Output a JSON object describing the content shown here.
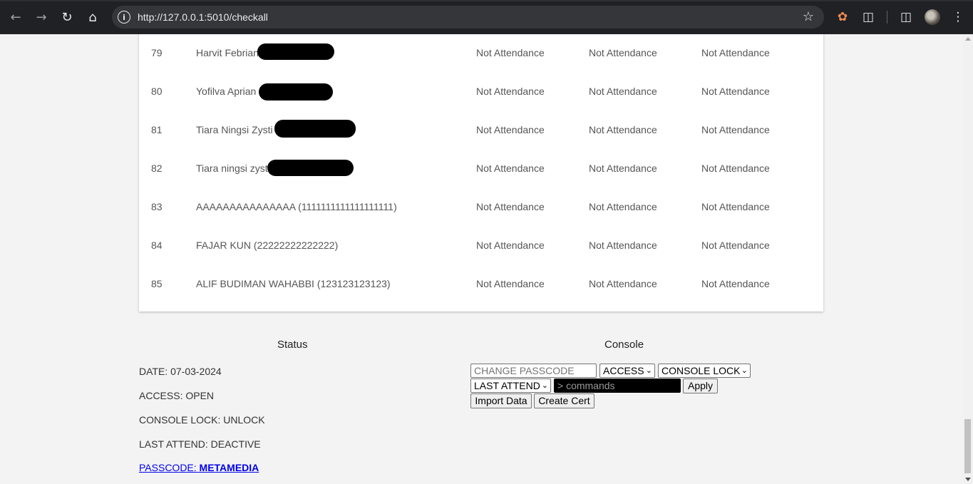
{
  "browser": {
    "url": "http://127.0.0.1:5010/checkall",
    "icons": [
      "back-icon",
      "forward-icon",
      "reload-icon",
      "home-icon",
      "site-info-icon",
      "bookmark-star-icon",
      "extension-puzzle-icon",
      "side-panel-icon",
      "profile-avatar",
      "more-menu-icon"
    ]
  },
  "table": {
    "rows": [
      {
        "no": "79",
        "name": "Harvit Febrian (",
        "a1": "Not Attendance",
        "a2": "Not Attendance",
        "a3": "Not Attendance"
      },
      {
        "no": "80",
        "name": "Yofilva Aprian",
        "a1": "Not Attendance",
        "a2": "Not Attendance",
        "a3": "Not Attendance"
      },
      {
        "no": "81",
        "name": "Tiara Ningsi Zysti",
        "a1": "Not Attendance",
        "a2": "Not Attendance",
        "a3": "Not Attendance"
      },
      {
        "no": "82",
        "name": "Tiara ningsi zyst",
        "a1": "Not Attendance",
        "a2": "Not Attendance",
        "a3": "Not Attendance"
      },
      {
        "no": "83",
        "name": "AAAAAAAAAAAAAAA (1111111111111111111)",
        "a1": "Not Attendance",
        "a2": "Not Attendance",
        "a3": "Not Attendance"
      },
      {
        "no": "84",
        "name": "FAJAR KUN (22222222222222)",
        "a1": "Not Attendance",
        "a2": "Not Attendance",
        "a3": "Not Attendance"
      },
      {
        "no": "85",
        "name": "ALIF BUDIMAN WAHABBI (123123123123)",
        "a1": "Not Attendance",
        "a2": "Not Attendance",
        "a3": "Not Attendance"
      }
    ]
  },
  "status": {
    "title": "Status",
    "date": "DATE: 07-03-2024",
    "access": "ACCESS: OPEN",
    "console_lock": "CONSOLE LOCK: UNLOCK",
    "last_attend": "LAST ATTEND: DEACTIVE",
    "passcode_label": "PASSCODE:",
    "passcode_value": "METAMEDIA"
  },
  "console": {
    "title": "Console",
    "passcode_placeholder": "CHANGE PASSCODE",
    "access_select": "ACCESS",
    "console_lock_select": "CONSOLE LOCK",
    "last_attend_select": "LAST ATTEND",
    "commands_placeholder": "> commands",
    "apply_label": "Apply",
    "import_label": "Import Data",
    "create_cert_label": "Create Cert"
  }
}
